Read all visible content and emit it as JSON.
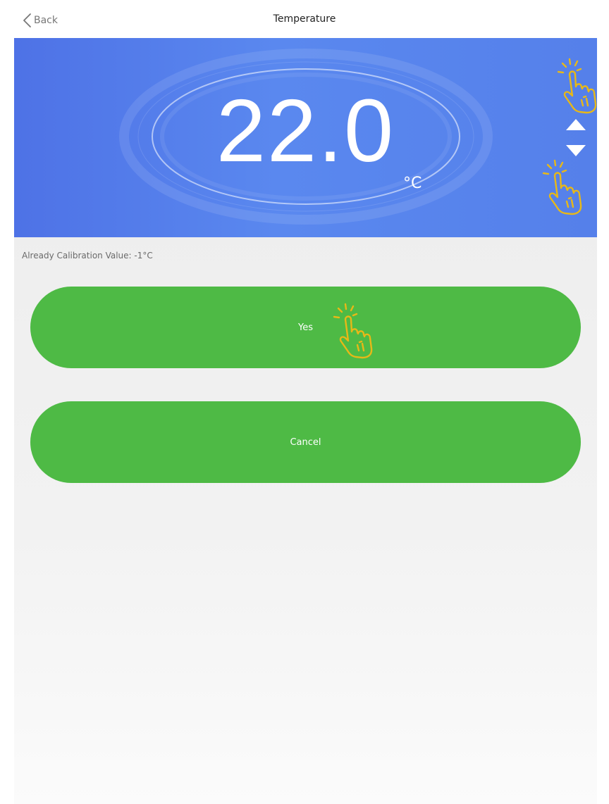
{
  "header": {
    "back_label": "Back",
    "title": "Temperature"
  },
  "display": {
    "temperature": "22.0",
    "unit": "°C"
  },
  "calibration": {
    "text": "Already Calibration Value:  -1°C"
  },
  "buttons": {
    "yes_label": "Yes",
    "cancel_label": "Cancel"
  },
  "icons": {
    "back": "chevron-left-icon",
    "increase": "triangle-up-icon",
    "decrease": "triangle-down-icon",
    "tap_hint": "tap-hand-icon"
  },
  "colors": {
    "hero_blue": "#5580ea",
    "button_green": "#4eba45",
    "tap_hint_yellow": "#e8b817"
  }
}
